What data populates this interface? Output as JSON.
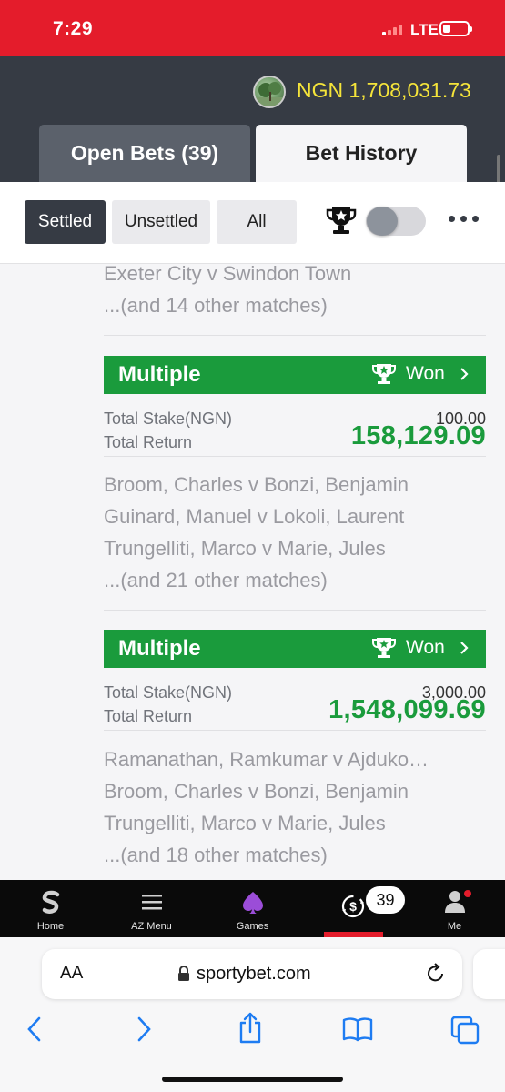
{
  "status_bar": {
    "time": "7:29",
    "network": "LTE"
  },
  "header": {
    "balance": "NGN 1,708,031.73",
    "tabs": [
      {
        "label": "Open Bets (39)",
        "active": false
      },
      {
        "label": "Bet History",
        "active": true
      }
    ]
  },
  "filters": {
    "buttons": [
      {
        "label": "Settled",
        "active": true
      },
      {
        "label": "Unsettled",
        "active": false
      },
      {
        "label": "All",
        "active": false
      }
    ],
    "trophy_icon": "trophy-star-icon",
    "toggle_on": false,
    "more_icon": "more-dots-icon"
  },
  "previous_bet": {
    "lines": [
      "Exeter City v Swindon Town",
      "...(and 14 other matches)"
    ]
  },
  "bets": [
    {
      "type": "Multiple",
      "status": "Won",
      "stake_label": "Total Stake(NGN)",
      "stake": "100.00",
      "return_label": "Total Return",
      "return": "158,129.09",
      "matches": [
        "Broom, Charles v Bonzi, Benjamin",
        "Guinard, Manuel v Lokoli, Laurent",
        "Trungelliti, Marco v Marie, Jules",
        "...(and 21 other matches)"
      ]
    },
    {
      "type": "Multiple",
      "status": "Won",
      "stake_label": "Total Stake(NGN)",
      "stake": "3,000.00",
      "return_label": "Total Return",
      "return": "1,548,099.69",
      "matches": [
        "Ramanathan, Ramkumar v Ajduko…",
        "Broom, Charles v Bonzi, Benjamin",
        "Trungelliti, Marco v Marie, Jules",
        "...(and 18 other matches)"
      ]
    }
  ],
  "bottom_nav": {
    "items": [
      {
        "label": "Home",
        "icon": "sporty-logo-icon"
      },
      {
        "label": "AZ Menu",
        "icon": "menu-icon"
      },
      {
        "label": "Games",
        "icon": "spade-icon"
      },
      {
        "label": "",
        "icon": "bet-slip-icon"
      },
      {
        "label": "Me",
        "icon": "user-icon"
      }
    ],
    "bet_count": "39"
  },
  "browser": {
    "aa_label": "AA",
    "url": "sportybet.com"
  },
  "colors": {
    "brand_red": "#e41c2b",
    "header_dark": "#363b44",
    "won_green": "#1a9b3c",
    "balance_yellow": "#f5e43a"
  }
}
